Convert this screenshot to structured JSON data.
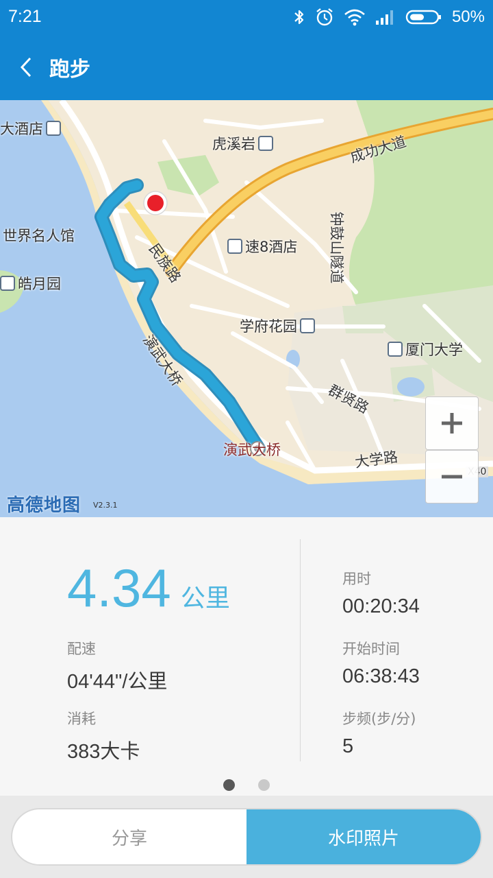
{
  "status_bar": {
    "time": "7:21",
    "battery_percent": "50%",
    "icons": [
      "bluetooth-icon",
      "alarm-icon",
      "wifi-icon",
      "signal-icon",
      "battery-icon"
    ]
  },
  "header": {
    "title": "跑步",
    "back_icon": "chevron-left-icon"
  },
  "map": {
    "labels": {
      "hotel_left": "大酒店",
      "huxiyan": "虎溪岩",
      "chenggong": "成功大道",
      "world_celeb": "世界名人馆",
      "haoyue": "皓月园",
      "minzu": "民族路",
      "su8": "速8酒店",
      "zhonggu": "钟鼓山隧道",
      "xuefu": "学府花园",
      "xiamen_univ": "厦门大学",
      "yanwu_road": "演武大桥",
      "qunxian": "群贤路",
      "yanwu_bridge": "演武大桥",
      "daxue": "大学路",
      "x40": "X40"
    },
    "logo": "高德地图",
    "version": "V2.3.1",
    "zoom_in_icon": "plus-icon",
    "zoom_out_icon": "minus-icon",
    "colors": {
      "route": "#2ba5d8",
      "start_marker": "#e8202a",
      "water": "#aacbef",
      "land": "#f3ead8",
      "green": "#c9e4b0",
      "arterial": "#f0b43c"
    }
  },
  "stats": {
    "distance": "4.34",
    "distance_unit": "公里",
    "pace_label": "配速",
    "pace_value": "04'44\"/公里",
    "calories_label": "消耗",
    "calories_value": "383大卡",
    "duration_label": "用时",
    "duration_value": "00:20:34",
    "start_label": "开始时间",
    "start_value": "06:38:43",
    "cadence_label": "步频(步/分)",
    "cadence_value": "5",
    "accent_color": "#4fb6e0"
  },
  "pager": {
    "pages": 2,
    "active": 1
  },
  "actions": {
    "share": "分享",
    "watermark_photo": "水印照片"
  }
}
